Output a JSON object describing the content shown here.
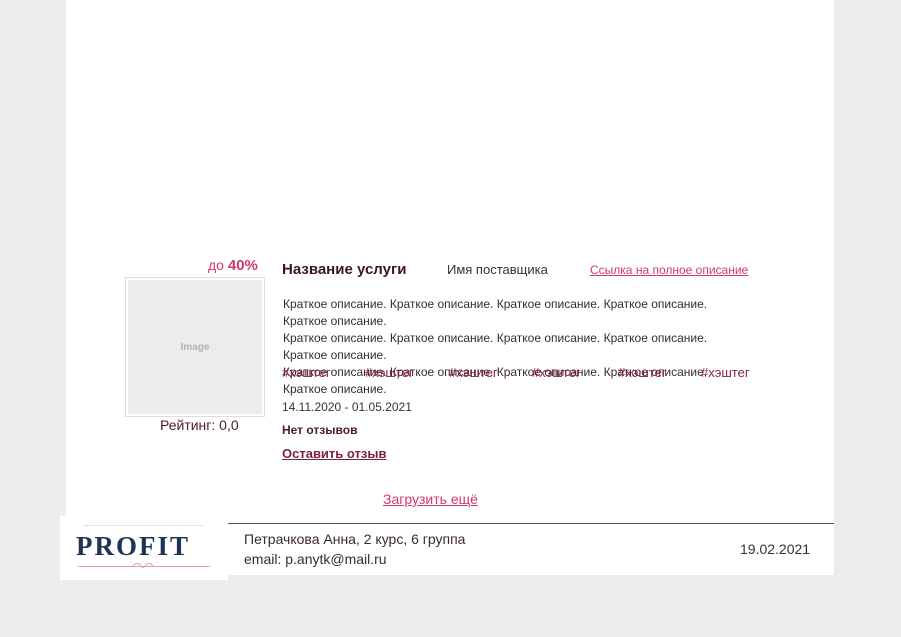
{
  "card": {
    "discount_prefix": "до",
    "discount_value": "40%",
    "image_placeholder": "Image",
    "rating": "Рейтинг: 0,0",
    "title": "Название услуги",
    "provider": "Имя поставщика",
    "full_link": "Ссылка на полное описание",
    "description": [
      "Краткое описание. Краткое описание. Краткое описание. Краткое описание. Краткое описание.",
      "Краткое описание. Краткое описание. Краткое описание. Краткое описание. Краткое описание.",
      "Краткое описание. Краткое описание. Краткое описание. Краткое описание. Краткое описание."
    ],
    "tags": [
      "#хэштег",
      "#хэштег",
      "#хэштег",
      "#хэштег",
      "#хэштег",
      "#хэштег"
    ],
    "dates": "14.11.2020 - 01.05.2021",
    "reviews_status": "Нет отзывов",
    "leave_review": "Оставить отзыв"
  },
  "load_more": "Загрузить ещё",
  "footer": {
    "logo_text": "PROFIT",
    "student": "Петрачкова Анна, 2 курс, 6 группа",
    "email": "email: p.anytk@mail.ru",
    "date": "19.02.2021"
  },
  "colors": {
    "accent": "#d2386c",
    "title": "#3c1428",
    "tag": "#8a2248",
    "logo": "#1d3554",
    "background": "#ececec"
  }
}
